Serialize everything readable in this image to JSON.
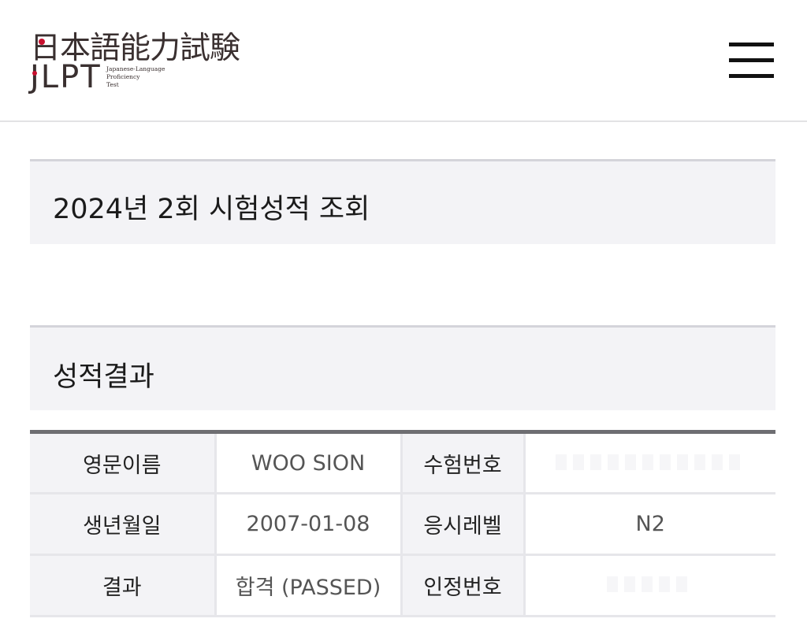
{
  "header": {
    "logo_kanji": "日本語能力試験",
    "logo_jlpt": "JLPT",
    "logo_sub_lines": [
      "Japanese-Language",
      "Proficiency",
      "Test"
    ],
    "menu_icon": "hamburger-menu-icon"
  },
  "page": {
    "title": "2024년 2회 시험성적 조회",
    "section_title": "성적결과"
  },
  "result_table": {
    "rows": [
      {
        "label1": "영문이름",
        "value1": "WOO SION",
        "label2": "수험번호",
        "value2": ""
      },
      {
        "label1": "생년월일",
        "value1": "2007-01-08",
        "label2": "응시레벨",
        "value2": "N2"
      },
      {
        "label1": "결과",
        "value1": "합격 (PASSED)",
        "label2": "인정번호",
        "value2": ""
      }
    ]
  },
  "colors": {
    "accent_red": "#c8102e",
    "section_bg": "#f3f3f6",
    "table_top_border": "#6e6e72"
  }
}
